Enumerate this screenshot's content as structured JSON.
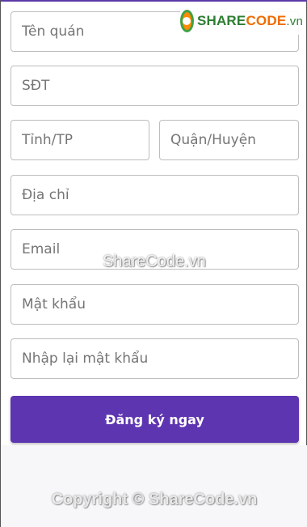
{
  "colors": {
    "accent": "#5e35b1",
    "field_border": "#bdbdbd",
    "placeholder": "#757575"
  },
  "form": {
    "store_name": {
      "placeholder": "Tên quán",
      "value": ""
    },
    "phone": {
      "placeholder": "SĐT",
      "value": ""
    },
    "province": {
      "placeholder": "Tỉnh/TP",
      "value": ""
    },
    "district": {
      "placeholder": "Quận/Huyện",
      "value": ""
    },
    "address": {
      "placeholder": "Địa chỉ",
      "value": ""
    },
    "email": {
      "placeholder": "Email",
      "value": ""
    },
    "password": {
      "placeholder": "Mật khẩu",
      "value": ""
    },
    "confirm_password": {
      "placeholder": "Nhập lại mật khẩu",
      "value": ""
    },
    "submit_label": "Đăng ký ngay"
  },
  "overlay": {
    "logo_text_1": "SHARE",
    "logo_text_2": "CODE",
    "logo_text_3": ".vn",
    "watermark": "ShareCode.vn",
    "copyright": "Copyright © ShareCode.vn"
  }
}
